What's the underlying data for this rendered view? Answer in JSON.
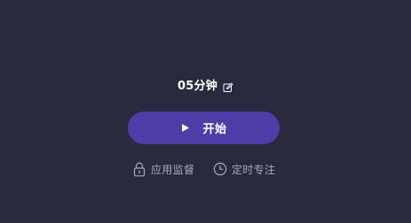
{
  "timer": {
    "duration_label": "05分钟",
    "edit_icon": "pencil-edit-icon"
  },
  "start": {
    "label": "开始",
    "icon": "play-icon"
  },
  "options": {
    "app_monitor_label": "应用监督",
    "app_monitor_icon": "lock-icon",
    "scheduled_focus_label": "定时专注",
    "scheduled_focus_icon": "clock-icon"
  },
  "colors": {
    "background": "#2a2a3e",
    "accent": "#4f3ca7",
    "primary_text": "#ffffff",
    "secondary_text": "#a9a9b8"
  }
}
